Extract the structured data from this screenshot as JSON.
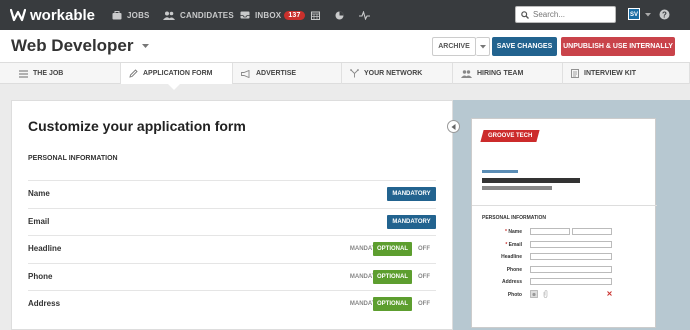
{
  "app": {
    "logo_text": "workable"
  },
  "topnav": {
    "jobs": "JOBS",
    "candidates": "CANDIDATES",
    "inbox": "INBOX",
    "inbox_count": "137",
    "search_placeholder": "Search...",
    "avatar_initials": "SV"
  },
  "header": {
    "job_title": "Web Developer",
    "archive_label": "ARCHIVE",
    "save_label": "SAVE CHANGES",
    "unpublish_label": "UNPUBLISH & USE INTERNALLY"
  },
  "tabs": [
    "THE JOB",
    "APPLICATION FORM",
    "ADVERTISE",
    "YOUR NETWORK",
    "HIRING TEAM",
    "INTERVIEW KIT"
  ],
  "form": {
    "heading": "Customize your application form",
    "section": "PERSONAL INFORMATION",
    "options": {
      "mandatory": "MANDATORY",
      "optional": "OPTIONAL",
      "off": "OFF"
    },
    "fields": [
      {
        "name": "Name",
        "state": "required"
      },
      {
        "name": "Email",
        "state": "required"
      },
      {
        "name": "Headline",
        "state": "optional"
      },
      {
        "name": "Phone",
        "state": "optional"
      },
      {
        "name": "Address",
        "state": "optional"
      }
    ]
  },
  "preview": {
    "brand": "GROOVE TECH",
    "section": "PERSONAL INFORMATION",
    "fields": [
      "Name",
      "Email",
      "Headline",
      "Phone",
      "Address",
      "Photo"
    ],
    "required_marker": "*"
  },
  "colors": {
    "nav_bg": "#383b3e",
    "save_blue": "#22638f",
    "unpublish_red": "#c9434a",
    "optional_green": "#5d9e2f",
    "brand_red": "#cc2b2b"
  }
}
